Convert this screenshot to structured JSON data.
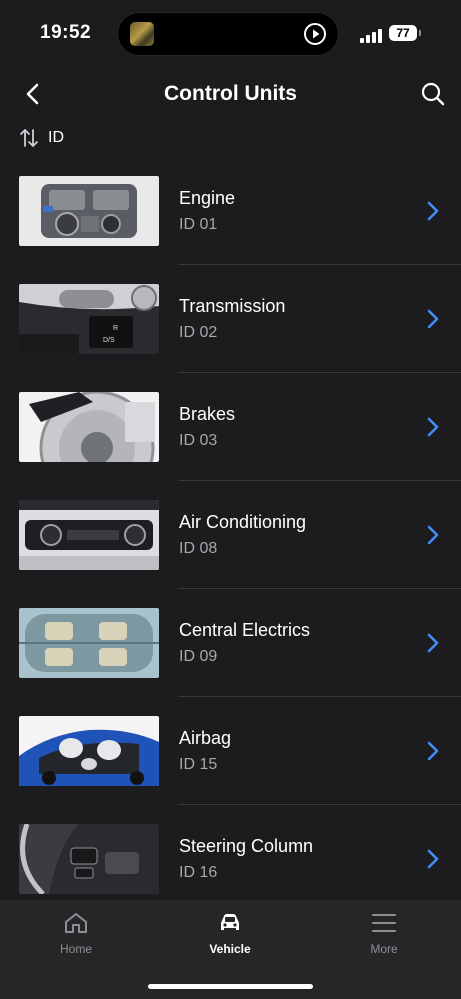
{
  "status_bar": {
    "time": "19:52",
    "battery": "77"
  },
  "header": {
    "title": "Control Units"
  },
  "sort": {
    "label": "ID"
  },
  "units": [
    {
      "name": "Engine",
      "id": "ID 01"
    },
    {
      "name": "Transmission",
      "id": "ID 02"
    },
    {
      "name": "Brakes",
      "id": "ID 03"
    },
    {
      "name": "Air Conditioning",
      "id": "ID 08"
    },
    {
      "name": "Central Electrics",
      "id": "ID 09"
    },
    {
      "name": "Airbag",
      "id": "ID 15"
    },
    {
      "name": "Steering Column",
      "id": "ID 16"
    }
  ],
  "tabs": [
    {
      "label": "Home",
      "icon": "home-icon",
      "active": false
    },
    {
      "label": "Vehicle",
      "icon": "car-icon",
      "active": true
    },
    {
      "label": "More",
      "icon": "menu-icon",
      "active": false
    }
  ],
  "colors": {
    "background": "#1c1c1e",
    "accent": "#3f8ef6",
    "secondary_text": "#a6a6ab",
    "tab_inactive": "#8e8e93"
  }
}
